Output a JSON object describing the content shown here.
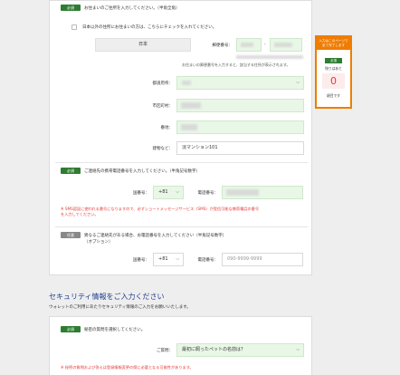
{
  "address": {
    "required_badge": "必須",
    "prompt": "お住まいのご住所を入力してください。（半角全角）",
    "overseas_label": "日本以外の住所にお住まいの方は、こちらにチェックを入れてください。",
    "country": "日本",
    "postal_label": "郵便番号：",
    "postal_separator": "-",
    "postal_note": "お住まいの郵便番号を入力すると、該当する住所が表示されます。",
    "prefecture_label": "都道府県：",
    "city_label": "市区町村：",
    "street_label": "番地：",
    "building_label": "建物など：",
    "building_value": "淡マンション101"
  },
  "mobile": {
    "required_badge": "必須",
    "prompt": "ご連絡先の携帯電話番号を入力してください。（半角記号数字）",
    "country_code_label": "国番号：",
    "country_code": "+81",
    "phone_label": "電話番号：",
    "note_line1": "※ SMS認証に使われる番号になりますので、必ずショートメッセージサービス（SMS）が受信可能な携帯電話の番号",
    "note_line2": "を入力してください。"
  },
  "other_phone": {
    "optional_badge": "任意",
    "prompt_line1": "異なるご連絡先がある場合、お電話番号を入力してください（半角記号数字）",
    "prompt_line2": "（オプション）",
    "country_code_label": "国番号：",
    "country_code": "+81",
    "phone_label": "電話番号：",
    "phone_placeholder": "090-9999-9999"
  },
  "security": {
    "title": "セキュリティ情報をご入力ください",
    "subtitle": "ウォレットのご利用にあたりセキュリティ情報のご入力をお願いいたします。",
    "required_badge": "必須",
    "prompt": "秘密の質問を選択してください。",
    "question_label": "ご質問：",
    "question_value": "最初に飼ったペットの名前は？",
    "note": "※ 秘密の質問および答えは登録情報変更の際に必要となる可能性があります。"
  },
  "sidebar": {
    "header_line1": "入力はこのページで",
    "header_line2": "全て完了します",
    "required_badge": "必須",
    "remaining_label": "残りはあと",
    "remaining_count": "0",
    "done_label": "項目です"
  },
  "icons": {
    "dropdown": "chevron-down-icon"
  },
  "colors": {
    "required_green": "#2e7d32",
    "input_green": "#e9f7e7",
    "error_red": "#e53935",
    "accent_orange": "#f07c00",
    "title_blue": "#1f3f8a"
  }
}
